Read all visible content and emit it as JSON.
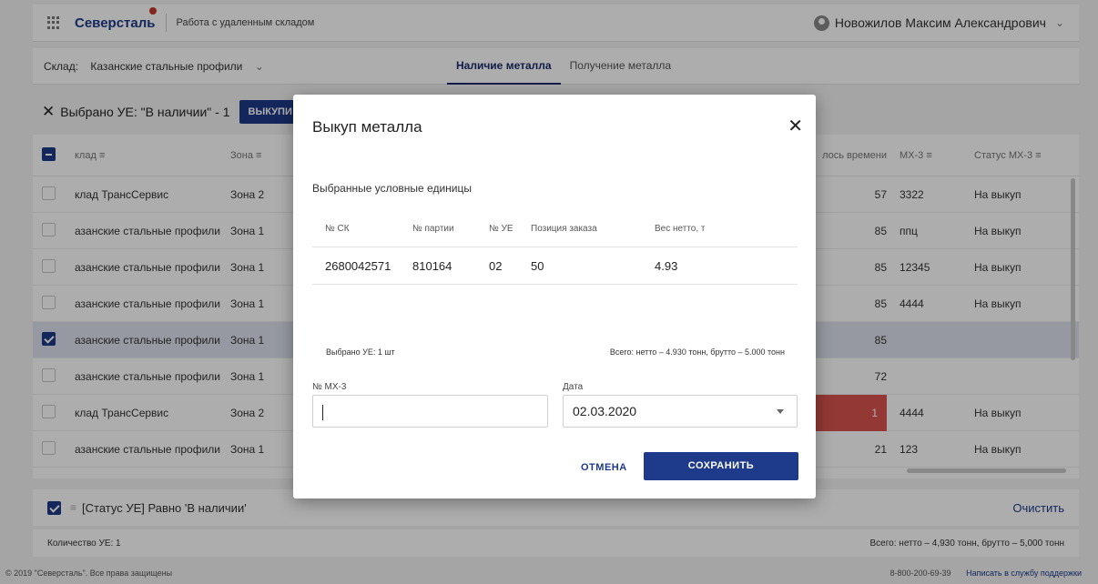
{
  "header": {
    "logo": "Северсталь",
    "app_name": "Работа с удаленным складом",
    "user_name": "Новожилов Максим Александрович"
  },
  "subheader": {
    "warehouse_label": "Склад:",
    "warehouse_value": "Казанские стальные профили",
    "tabs": [
      {
        "label": "Наличие металла",
        "active": true
      },
      {
        "label": "Получение металла",
        "active": false
      }
    ]
  },
  "selbar": {
    "text": "Выбрано УЕ: \"В наличии\" - 1",
    "buy_label": "ВЫКУПИ"
  },
  "table": {
    "headers": {
      "warehouse": "клад",
      "zone": "Зона",
      "time": "лось времени",
      "mx": "МХ-3",
      "status": "Статус МХ-3"
    },
    "rows": [
      {
        "warehouse": "клад ТрансСервис",
        "zone": "Зона 2",
        "time": "57",
        "mx": "3322",
        "status": "На выкуп",
        "checked": false
      },
      {
        "warehouse": "азанские стальные профили",
        "zone": "Зона 1",
        "time": "85",
        "mx": "ппц",
        "status": "На выкуп",
        "checked": false
      },
      {
        "warehouse": "азанские стальные профили",
        "zone": "Зона 1",
        "time": "85",
        "mx": "12345",
        "status": "На выкуп",
        "checked": false
      },
      {
        "warehouse": "азанские стальные профили",
        "zone": "Зона 1",
        "time": "85",
        "mx": "4444",
        "status": "На выкуп",
        "checked": false
      },
      {
        "warehouse": "азанские стальные профили",
        "zone": "Зона 1",
        "time": "85",
        "mx": "",
        "status": "",
        "checked": true
      },
      {
        "warehouse": "азанские стальные профили",
        "zone": "Зона 1",
        "time": "72",
        "mx": "",
        "status": "",
        "checked": false
      },
      {
        "warehouse": "клад ТрансСервис",
        "zone": "Зона 2",
        "time": "1",
        "mx": "4444",
        "status": "На выкуп",
        "checked": false
      },
      {
        "warehouse": "азанские стальные профили",
        "zone": "Зона 1",
        "time": "21",
        "mx": "123",
        "status": "На выкуп",
        "checked": false
      }
    ]
  },
  "filterbar": {
    "text": "[Статус УЕ] Равно 'В наличии'",
    "clear_label": "Очистить"
  },
  "countbar": {
    "count": "Количество УЕ: 1",
    "total": "Всего: нетто – 4,930 тонн, брутто – 5,000 тонн"
  },
  "footer": {
    "copyright": "© 2019 \"Северсталь\". Все права защищены",
    "phone": "8-800-200-69-39",
    "support": "Написать в службу поддержки"
  },
  "modal": {
    "title": "Выкуп металла",
    "subtitle": "Выбранные условные единицы",
    "columns": [
      "№ СК",
      "№ партии",
      "№ УЕ",
      "Позиция заказа",
      "Вес нетто, т"
    ],
    "row": {
      "sk": "2680042571",
      "batch": "810164",
      "ue": "02",
      "position": "50",
      "weight": "4.93"
    },
    "selected": "Выбрано УЕ: 1 шт",
    "total": "Всего: нетто – 4.930 тонн, брутто – 5.000 тонн",
    "mx_label": "№ МХ-3",
    "mx_value": "",
    "date_label": "Дата",
    "date_value": "02.03.2020",
    "cancel_label": "ОТМЕНА",
    "save_label": "СОХРАНИТЬ"
  },
  "colors": {
    "accent": "#1e3a8a",
    "alert": "#d9534f",
    "selected_row": "#dde2ee"
  }
}
